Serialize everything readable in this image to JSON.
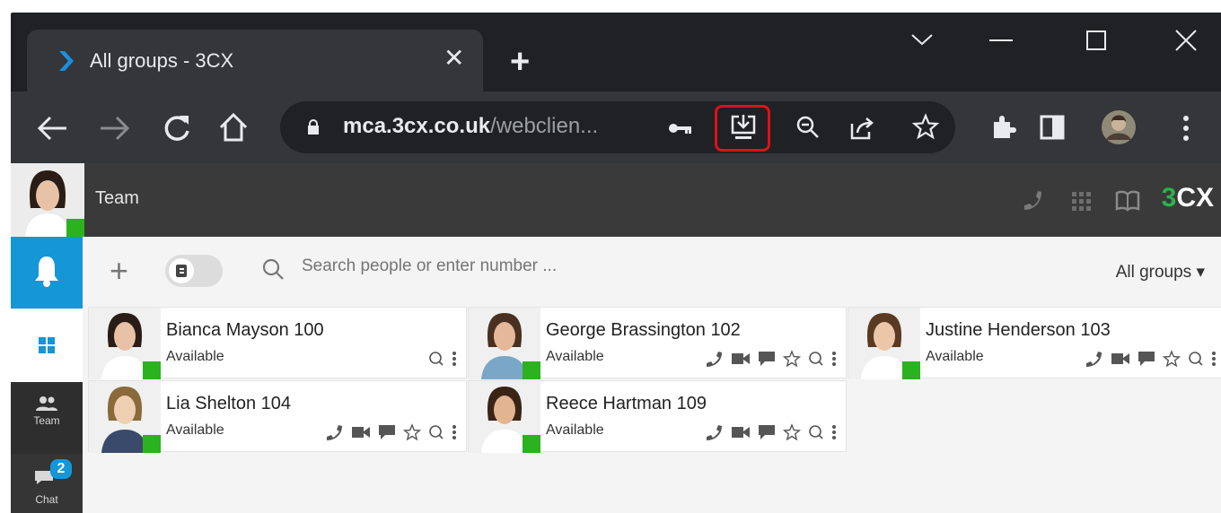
{
  "browser": {
    "tab_title": "All groups - 3CX",
    "url_host": "mca.3cx.co.uk",
    "url_path": "/webclien...",
    "new_tab_label": "+",
    "tab_close_label": "✕"
  },
  "app": {
    "header_title": "Team",
    "brand_number": "3",
    "brand_text": "CX",
    "sidebar": {
      "team_label": "Team",
      "chat_label": "Chat",
      "chat_badge": "2"
    },
    "search": {
      "placeholder": "Search people or enter number ...",
      "groups_label": "All groups ▾"
    },
    "contacts": [
      {
        "name": "Bianca Mayson 100",
        "status": "Available"
      },
      {
        "name": "George Brassington 102",
        "status": "Available"
      },
      {
        "name": "Justine Henderson 103",
        "status": "Available"
      },
      {
        "name": "Lia Shelton 104",
        "status": "Available"
      },
      {
        "name": "Reece Hartman 109",
        "status": "Available"
      }
    ]
  },
  "colors": {
    "accent_blue": "#1596d6",
    "presence_green": "#2bb21f",
    "highlight_red": "#e0101a"
  }
}
